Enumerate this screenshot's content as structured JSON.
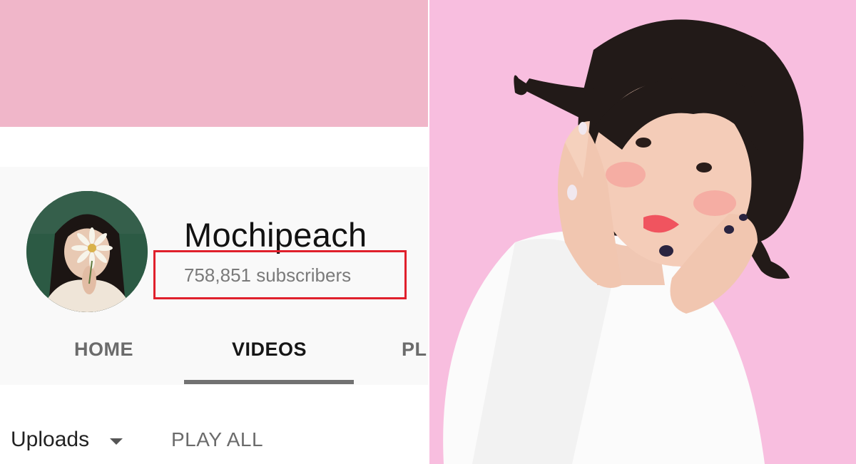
{
  "channel": {
    "name": "Mochipeach",
    "subscribers": "758,851 subscribers"
  },
  "tabs": [
    {
      "label": "HOME",
      "selected": false
    },
    {
      "label": "VIDEOS",
      "selected": true
    },
    {
      "label": "PL",
      "selected": false
    }
  ],
  "uploads": {
    "label": "Uploads",
    "play_all_label": "PLAY ALL"
  },
  "colors": {
    "banner": "#f0b6c9",
    "highlight_box": "#e0202c",
    "photo_background": "#f7b8dc"
  }
}
